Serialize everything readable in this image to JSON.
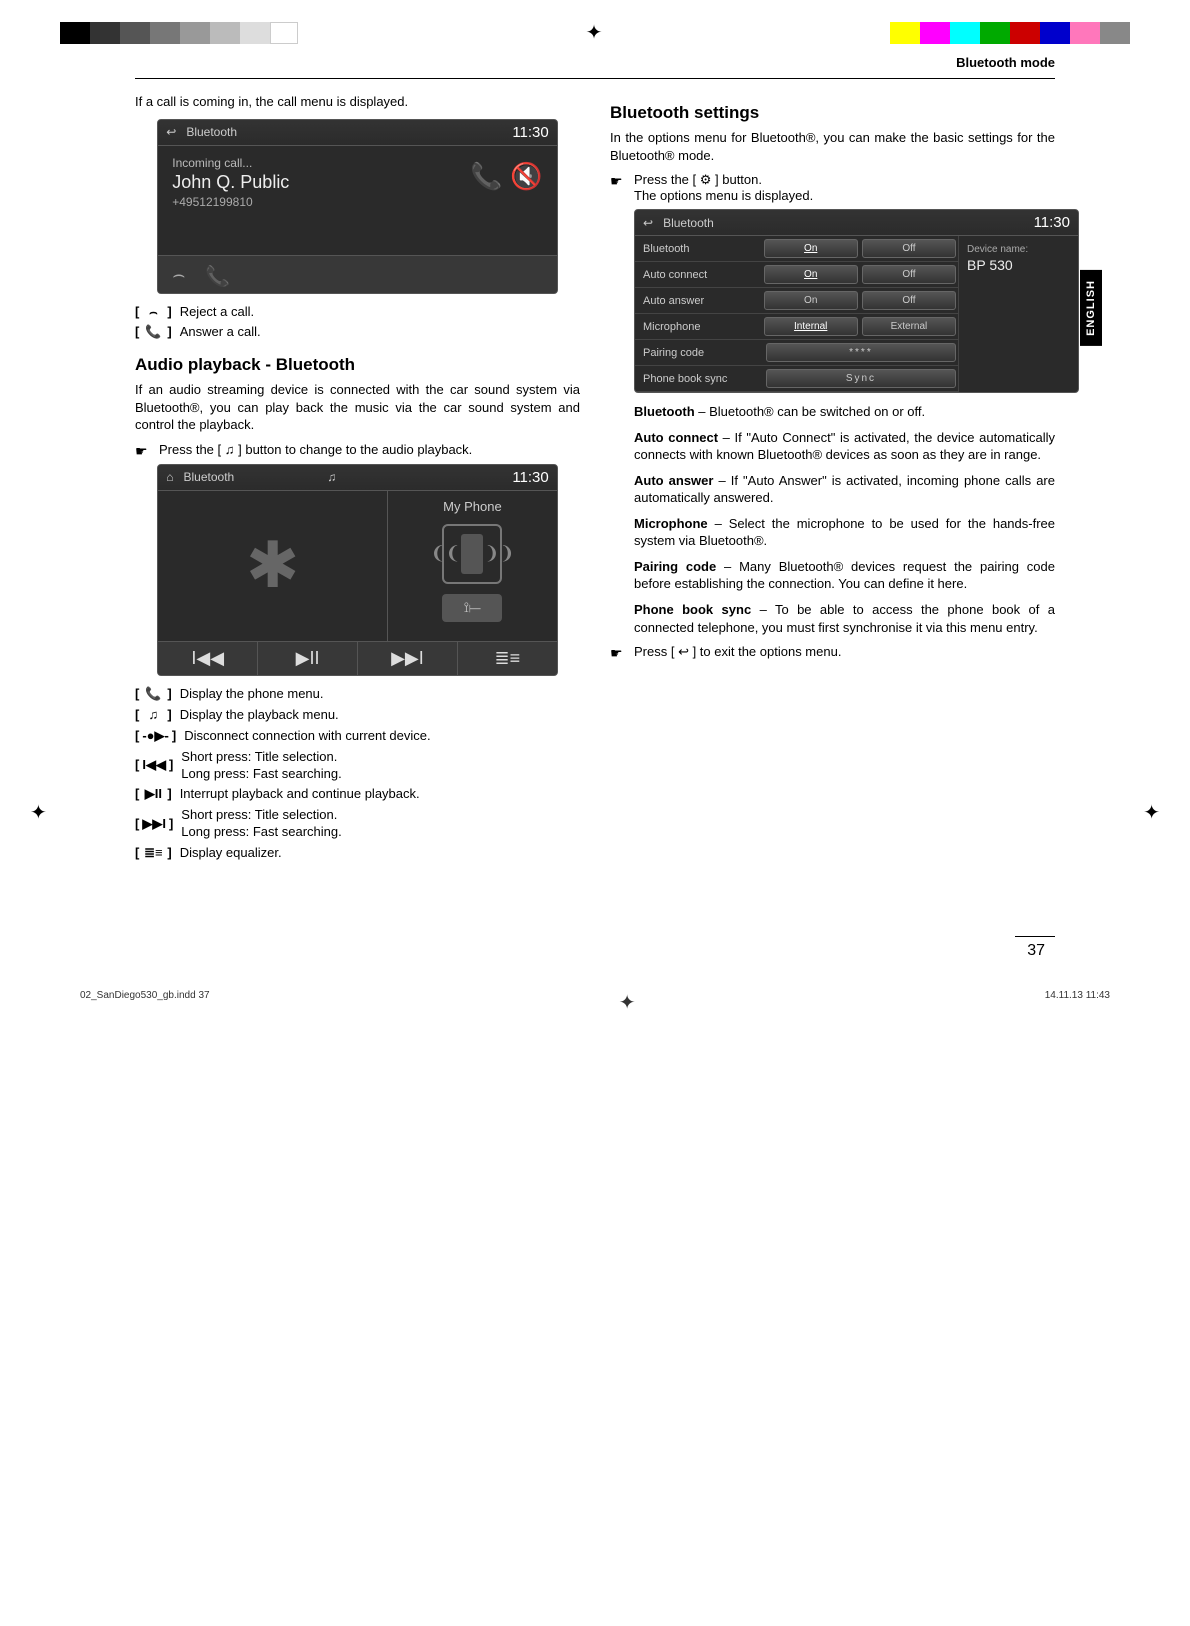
{
  "header_label": "Bluetooth mode",
  "side_tab": "ENGLISH",
  "page_number": "37",
  "footer": {
    "file": "02_SanDiego530_gb.indd   37",
    "date": "14.11.13   11:43"
  },
  "left": {
    "intro": "If a call is coming in, the call menu is displayed.",
    "screen1": {
      "title": "Bluetooth",
      "time": "11:30",
      "incoming": "Incoming call...",
      "caller": "John Q. Public",
      "number": "+49512199810"
    },
    "call_actions": {
      "reject": "Reject a call.",
      "answer": "Answer a call."
    },
    "audio_heading": "Audio playback - Bluetooth",
    "audio_intro": "If an audio streaming device is connected with the car sound system via Bluetooth®, you can play back the music via the car sound system and control the playback.",
    "audio_step": "Press the [ ♫ ] button to change to the audio playback.",
    "screen2": {
      "title": "Bluetooth",
      "time": "11:30",
      "device": "My Phone"
    },
    "playback_actions": {
      "phone_menu": "Display the phone menu.",
      "playback_menu": "Display the playback menu.",
      "disconnect": "Disconnect connection with current device.",
      "prev": "Short press: Title selection.\nLong press: Fast searching.",
      "pause": "Interrupt playback and continue playback.",
      "next": "Short press: Title selection.\nLong press: Fast searching.",
      "eq": "Display equalizer."
    }
  },
  "right": {
    "heading": "Bluetooth settings",
    "intro": "In the options menu for Bluetooth®, you can make the basic settings for the Bluetooth® mode.",
    "step1": "Press the [ ⚙ ] button.",
    "step1_sub": "The options menu is displayed.",
    "screen3": {
      "title": "Bluetooth",
      "time": "11:30",
      "rows": {
        "bluetooth": {
          "label": "Bluetooth",
          "a": "On",
          "b": "Off"
        },
        "autoconnect": {
          "label": "Auto connect",
          "a": "On",
          "b": "Off"
        },
        "autoanswer": {
          "label": "Auto answer",
          "a": "On",
          "b": "Off"
        },
        "microphone": {
          "label": "Microphone",
          "a": "Internal",
          "b": "External"
        },
        "pairing": {
          "label": "Pairing code",
          "val": "****"
        },
        "sync": {
          "label": "Phone book sync",
          "val": "Sync"
        }
      },
      "devname_label": "Device name:",
      "devname": "BP 530"
    },
    "defs": {
      "bluetooth": "Bluetooth – Bluetooth® can be switched on or off.",
      "autoconnect": "Auto connect – If \"Auto Connect\" is activated, the device automatically connects with known Bluetooth® devices as soon as they are in range.",
      "autoanswer": "Auto answer – If \"Auto Answer\" is activated, incoming phone calls are automatically answered.",
      "microphone": "Microphone – Select the microphone to be used for the hands-free system via Bluetooth®.",
      "pairing": "Pairing code – Many Bluetooth® devices request the pairing code before establishing the connection. You can define it here.",
      "sync": "Phone book sync – To be able to access the phone book of a connected telephone, you must first synchronise it via this menu entry."
    },
    "exit": "Press [ ↩ ] to exit the options menu."
  }
}
